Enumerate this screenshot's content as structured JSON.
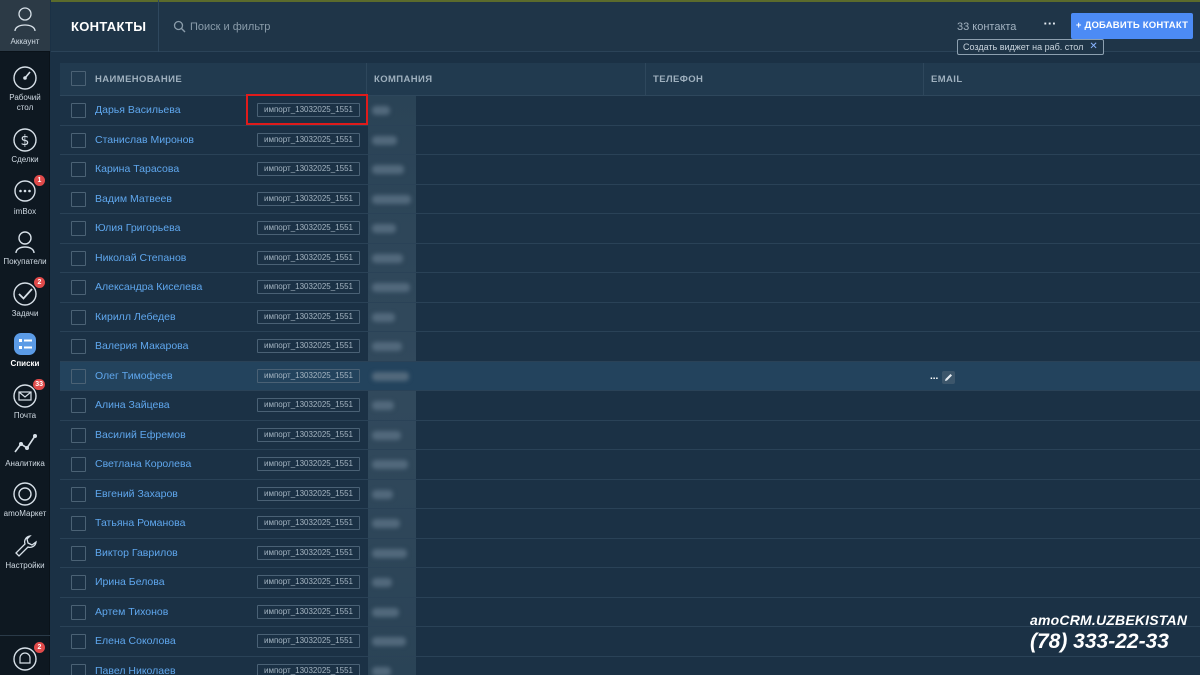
{
  "colors": {
    "accent": "#4c8bf5",
    "link": "#5fa7ee",
    "badge": "#e04a4a",
    "highlight_box": "#e01b1b"
  },
  "sidebar": {
    "account_label": "Аккаунт",
    "items": [
      {
        "label": "Рабочий стол",
        "icon": "dashboard-icon"
      },
      {
        "label": "Сделки",
        "icon": "dollar-icon"
      },
      {
        "label": "imBox",
        "icon": "chat-icon",
        "badge": "1"
      },
      {
        "label": "Покупатели",
        "icon": "customers-icon"
      },
      {
        "label": "Задачи",
        "icon": "tasks-icon",
        "badge": "2"
      },
      {
        "label": "Списки",
        "icon": "lists-icon",
        "active": true
      },
      {
        "label": "Почта",
        "icon": "mail-icon",
        "badge": "33"
      },
      {
        "label": "Аналитика",
        "icon": "analytics-icon"
      },
      {
        "label": "amoМаркет",
        "icon": "market-icon"
      },
      {
        "label": "Настройки",
        "icon": "settings-icon"
      }
    ],
    "notifications_badge": "2"
  },
  "header": {
    "title": "КОНТАКТЫ",
    "search_placeholder": "Поиск и фильтр",
    "count": "33 контакта",
    "more_label": "···",
    "add_button": "+ ДОБАВИТЬ КОНТАКТ",
    "tooltip": "Создать виджет на раб. стол",
    "tooltip_close": "✕"
  },
  "table": {
    "columns": [
      "НАИМЕНОВАНИЕ",
      "КОМПАНИЯ",
      "ТЕЛЕФОН",
      "EMAIL"
    ],
    "tag": "импорт_13032025_1551",
    "highlighted_row": 9,
    "rows": [
      "Дарья Васильева",
      "Станислав Миронов",
      "Карина Тарасова",
      "Вадим Матвеев",
      "Юлия Григорьева",
      "Николай Степанов",
      "Александра Киселева",
      "Кирилл Лебедев",
      "Валерия Макарова",
      "Олег Тимофеев",
      "Алина Зайцева",
      "Василий Ефремов",
      "Светлана Королева",
      "Евгений Захаров",
      "Татьяна Романова",
      "Виктор Гаврилов",
      "Ирина Белова",
      "Артем Тихонов",
      "Елена Соколова",
      "Павел Николаев"
    ],
    "row_actions": {
      "more": "...",
      "edit_icon": "pencil-icon"
    }
  },
  "watermark": {
    "brand": "amoCRM.UZBEKISTAN",
    "phone": "(78) 333-22-33"
  }
}
